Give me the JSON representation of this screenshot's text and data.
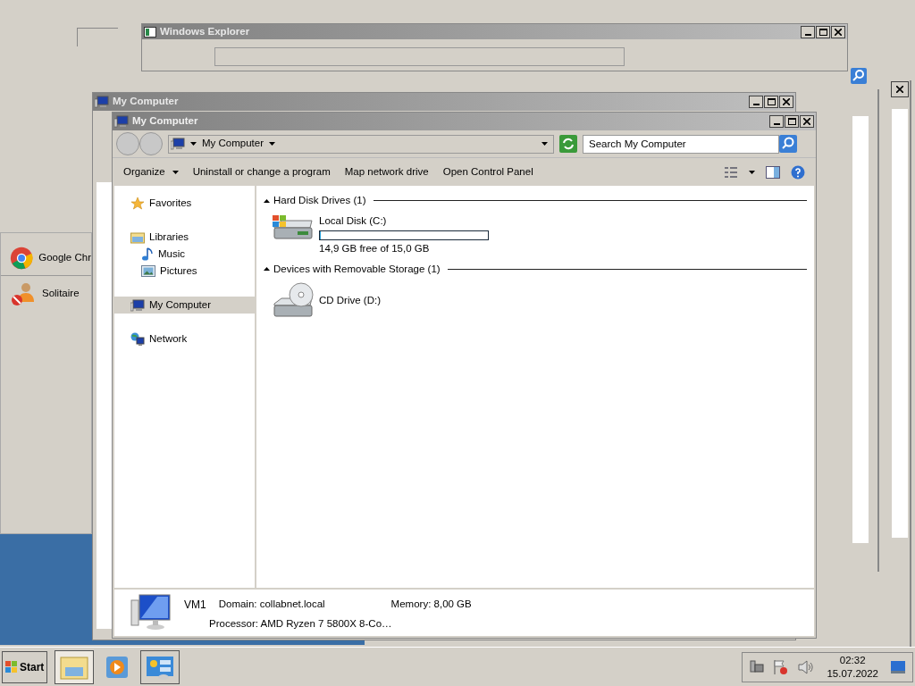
{
  "ghost_windows": [
    {
      "title": "Windows Explorer"
    },
    {
      "title": "My Computer"
    }
  ],
  "start_menu": {
    "items": [
      {
        "label": "Google Chr",
        "kind": "browser"
      },
      {
        "label": "Solitaire",
        "kind": "game"
      }
    ]
  },
  "window": {
    "title": "My Computer",
    "breadcrumb": "My Computer",
    "search": {
      "placeholder": "Search My Computer"
    },
    "toolbar": [
      {
        "label": "Organize",
        "kind": "menu"
      },
      {
        "label": "Uninstall or change a program",
        "kind": "plain"
      },
      {
        "label": "Map network drive",
        "kind": "plain"
      },
      {
        "label": "Open Control Panel",
        "kind": "plain"
      }
    ],
    "nav": [
      {
        "label": "Favorites",
        "kind": "star",
        "selected": false
      },
      {
        "label": "Libraries",
        "kind": "library",
        "selected": false,
        "children": [
          {
            "label": "Music",
            "kind": "music",
            "selected": false
          },
          {
            "label": "Pictures",
            "kind": "pictures",
            "selected": false
          }
        ]
      },
      {
        "label": "My Computer",
        "kind": "computer",
        "selected": true
      },
      {
        "label": "Network",
        "kind": "network",
        "selected": false
      }
    ],
    "groups": [
      {
        "title": "Hard Disk Drives (1)",
        "items": [
          {
            "name": "Local Disk (C:)",
            "kind": "disk",
            "level": 0.007,
            "free": "14,9 GB free of 15,0 GB"
          }
        ]
      },
      {
        "title": "Devices with Removable Storage (1)",
        "items": [
          {
            "name": "CD Drive (D:)",
            "kind": "cd"
          }
        ]
      }
    ],
    "details": {
      "name": "VM1",
      "domain_label": "Domain:",
      "domain": "collabnet.local",
      "memory_label": "Memory:",
      "memory": "8,00 GB",
      "processor_label": "Processor:",
      "processor": "AMD Ryzen 7 5800X 8-Co…"
    }
  },
  "taskbar": {
    "start": "Start",
    "time": "02:32",
    "date": "15.07.2022"
  }
}
